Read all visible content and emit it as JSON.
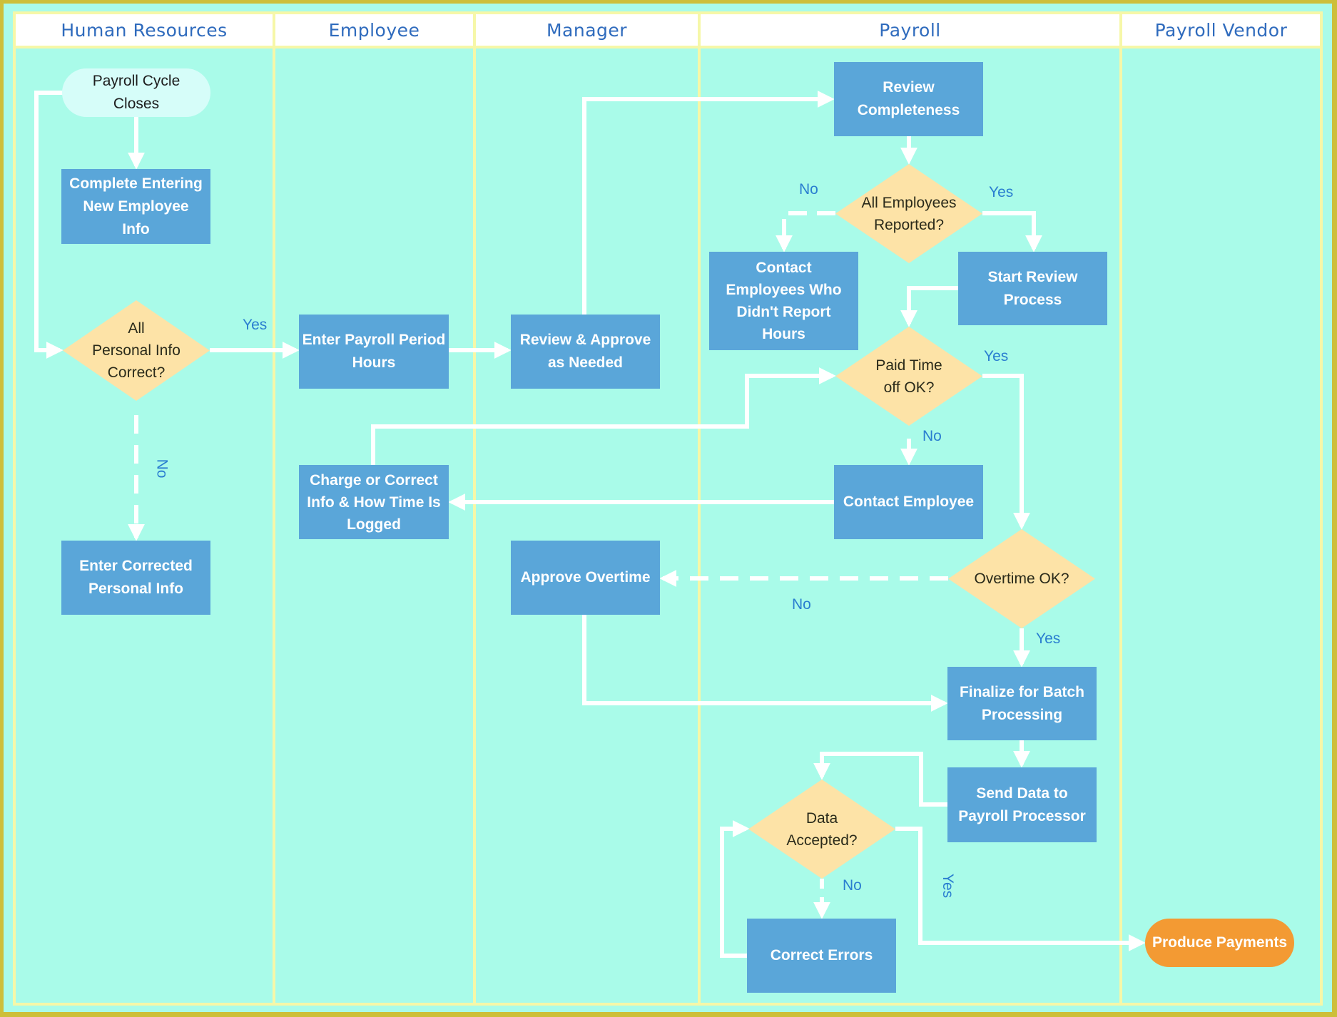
{
  "diagram": {
    "type": "cross-functional flowchart",
    "colors": {
      "outer_border": "#cdbf3a",
      "lane_background": "#a9fbe9",
      "lane_divider": "#f6f7a8",
      "header_background": "#ffffff",
      "header_text": "#2f6bbd",
      "process_fill": "#5aa6d9",
      "decision_fill": "#fde3a7",
      "start_fill": "#d6fdf9",
      "end_fill": "#f39a33",
      "connector": "#ffffff",
      "edge_label": "#2a7ed0"
    },
    "lanes": [
      {
        "id": "hr",
        "label": "Human Resources"
      },
      {
        "id": "employee",
        "label": "Employee"
      },
      {
        "id": "manager",
        "label": "Manager"
      },
      {
        "id": "payroll",
        "label": "Payroll"
      },
      {
        "id": "vendor",
        "label": "Payroll Vendor"
      }
    ],
    "nodes": {
      "payroll_cycle_closes": {
        "type": "start",
        "lane": "hr",
        "label": "Payroll Cycle\nCloses"
      },
      "complete_entering": {
        "type": "process",
        "lane": "hr",
        "label": "Complete Entering\nNew Employee\nInfo"
      },
      "all_personal_info": {
        "type": "decision",
        "lane": "hr",
        "label": "All\nPersonal Info\nCorrect?"
      },
      "enter_corrected": {
        "type": "process",
        "lane": "hr",
        "label": "Enter Corrected\nPersonal Info"
      },
      "enter_payroll_hours": {
        "type": "process",
        "lane": "employee",
        "label": "Enter Payroll Period\nHours"
      },
      "charge_or_correct": {
        "type": "process",
        "lane": "employee",
        "label": "Charge or Correct\nInfo & How Time Is\nLogged"
      },
      "review_approve": {
        "type": "process",
        "lane": "manager",
        "label": "Review & Approve\nas Needed"
      },
      "approve_overtime": {
        "type": "process",
        "lane": "manager",
        "label": "Approve Overtime"
      },
      "review_completeness": {
        "type": "process",
        "lane": "payroll",
        "label": "Review\nCompleteness"
      },
      "all_employees_reported": {
        "type": "decision",
        "lane": "payroll",
        "label": "All Employees\nReported?"
      },
      "contact_employees_who": {
        "type": "process",
        "lane": "payroll",
        "label": "Contact\nEmployees Who\nDidn't Report\nHours"
      },
      "start_review": {
        "type": "process",
        "lane": "payroll",
        "label": "Start Review\nProcess"
      },
      "paid_time_off": {
        "type": "decision",
        "lane": "payroll",
        "label": "Paid Time\noff OK?"
      },
      "contact_employee": {
        "type": "process",
        "lane": "payroll",
        "label": "Contact Employee"
      },
      "overtime_ok": {
        "type": "decision",
        "lane": "payroll",
        "label": "Overtime OK?"
      },
      "finalize_batch": {
        "type": "process",
        "lane": "payroll",
        "label": "Finalize for Batch\nProcessing"
      },
      "send_data": {
        "type": "process",
        "lane": "payroll",
        "label": "Send Data to\nPayroll Processor"
      },
      "data_accepted": {
        "type": "decision",
        "lane": "payroll",
        "label": "Data\nAccepted?"
      },
      "correct_errors": {
        "type": "process",
        "lane": "payroll",
        "label": "Correct Errors"
      },
      "produce_payments": {
        "type": "end",
        "lane": "vendor",
        "label": "Produce Payments"
      }
    },
    "edges": [
      {
        "from": "payroll_cycle_closes",
        "to": "complete_entering",
        "label": "",
        "style": "solid"
      },
      {
        "from": "payroll_cycle_closes",
        "to": "all_personal_info",
        "label": "",
        "style": "solid"
      },
      {
        "from": "all_personal_info",
        "to": "enter_payroll_hours",
        "label": "Yes",
        "style": "solid"
      },
      {
        "from": "all_personal_info",
        "to": "enter_corrected",
        "label": "No",
        "style": "dashed"
      },
      {
        "from": "enter_payroll_hours",
        "to": "review_approve",
        "label": "",
        "style": "solid"
      },
      {
        "from": "review_approve",
        "to": "review_completeness",
        "label": "",
        "style": "solid"
      },
      {
        "from": "review_completeness",
        "to": "all_employees_reported",
        "label": "",
        "style": "solid"
      },
      {
        "from": "all_employees_reported",
        "to": "contact_employees_who",
        "label": "No",
        "style": "dashed"
      },
      {
        "from": "all_employees_reported",
        "to": "start_review",
        "label": "Yes",
        "style": "solid"
      },
      {
        "from": "start_review",
        "to": "paid_time_off",
        "label": "",
        "style": "solid"
      },
      {
        "from": "charge_or_correct",
        "to": "paid_time_off",
        "label": "",
        "style": "solid"
      },
      {
        "from": "paid_time_off",
        "to": "contact_employee",
        "label": "No",
        "style": "solid"
      },
      {
        "from": "paid_time_off",
        "to": "overtime_ok",
        "label": "Yes",
        "style": "solid"
      },
      {
        "from": "contact_employee",
        "to": "charge_or_correct",
        "label": "",
        "style": "solid"
      },
      {
        "from": "overtime_ok",
        "to": "approve_overtime",
        "label": "No",
        "style": "dashed"
      },
      {
        "from": "overtime_ok",
        "to": "finalize_batch",
        "label": "Yes",
        "style": "solid"
      },
      {
        "from": "approve_overtime",
        "to": "finalize_batch",
        "label": "",
        "style": "solid"
      },
      {
        "from": "finalize_batch",
        "to": "send_data",
        "label": "",
        "style": "solid"
      },
      {
        "from": "send_data",
        "to": "data_accepted",
        "label": "",
        "style": "solid"
      },
      {
        "from": "data_accepted",
        "to": "correct_errors",
        "label": "No",
        "style": "dashed"
      },
      {
        "from": "correct_errors",
        "to": "data_accepted",
        "label": "",
        "style": "solid"
      },
      {
        "from": "data_accepted",
        "to": "produce_payments",
        "label": "Yes",
        "style": "solid"
      }
    ],
    "edge_labels": {
      "personal_yes": "Yes",
      "personal_no": "No",
      "reported_no": "No",
      "reported_yes": "Yes",
      "pto_yes": "Yes",
      "pto_no": "No",
      "overtime_no": "No",
      "overtime_yes": "Yes",
      "accepted_no": "No",
      "accepted_yes": "Yes"
    }
  }
}
